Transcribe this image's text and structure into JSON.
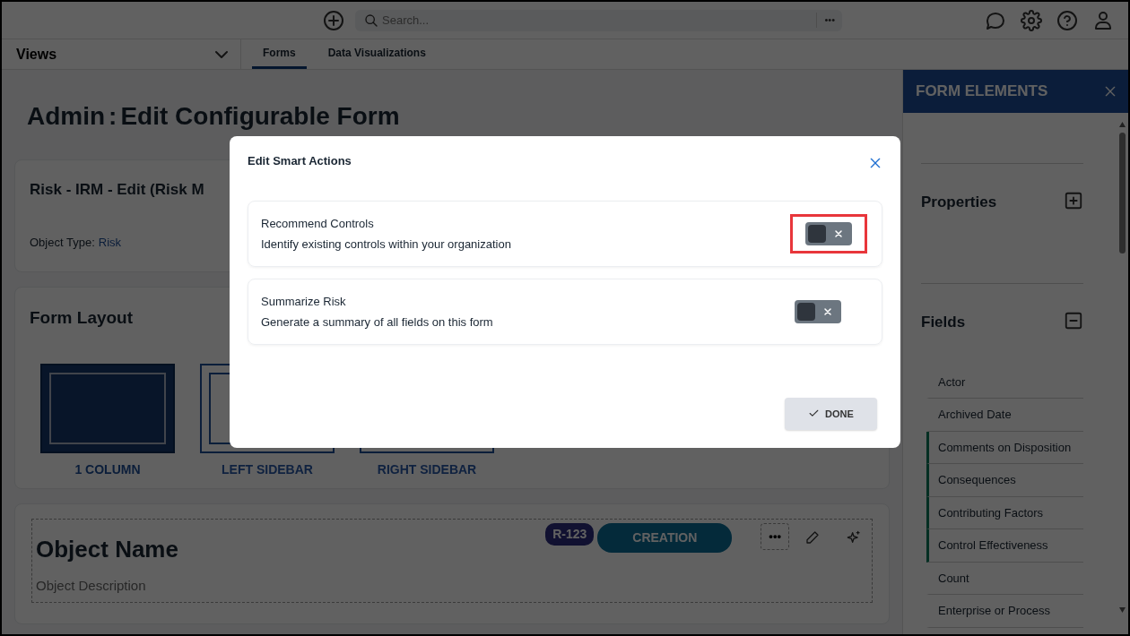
{
  "top_bar": {
    "search": {
      "placeholder": "Search..."
    },
    "more_label": "•••"
  },
  "views": {
    "label": "Views"
  },
  "tabs": [
    {
      "label": "Forms",
      "selected": true
    },
    {
      "label": "Data Visualizations",
      "selected": false
    }
  ],
  "page": {
    "title_prefix": "Admin",
    "title_separator": ":",
    "title": "Edit Configurable Form",
    "form_name": "Risk - IRM - Edit (Risk M",
    "object_type_label": "Object Type:",
    "object_type": "Risk",
    "layout_title": "Form Layout",
    "layouts": [
      {
        "kind": "one",
        "label": "1 COLUMN",
        "selected": true
      },
      {
        "kind": "left",
        "label": "LEFT SIDEBAR",
        "selected": false
      },
      {
        "kind": "right",
        "label": "RIGHT SIDEBAR",
        "selected": false
      }
    ],
    "object_name": "Object Name",
    "object_description": "Object Description",
    "record_id": "R-123",
    "workflow_state": "CREATION",
    "more_label": "•••"
  },
  "panel": {
    "title": "FORM ELEMENTS",
    "sections": [
      {
        "title": "Properties",
        "expanded": false
      },
      {
        "title": "Fields",
        "expanded": true
      }
    ],
    "fields": [
      {
        "label": "Actor",
        "highlighted": false
      },
      {
        "label": "Archived Date",
        "highlighted": false
      },
      {
        "label": "Comments on Disposition",
        "highlighted": true
      },
      {
        "label": "Consequences",
        "highlighted": true
      },
      {
        "label": "Contributing Factors",
        "highlighted": true
      },
      {
        "label": "Control Effectiveness",
        "highlighted": true
      },
      {
        "label": "Count",
        "highlighted": false
      },
      {
        "label": "Enterprise or Process",
        "highlighted": false
      }
    ]
  },
  "modal": {
    "title": "Edit Smart Actions",
    "actions": [
      {
        "name": "Recommend Controls",
        "description": "Identify existing controls within your organization",
        "on": false,
        "highlighted": true
      },
      {
        "name": "Summarize Risk",
        "description": "Generate a summary of all fields on this form",
        "on": false,
        "highlighted": false
      }
    ],
    "done_label": "DONE"
  }
}
